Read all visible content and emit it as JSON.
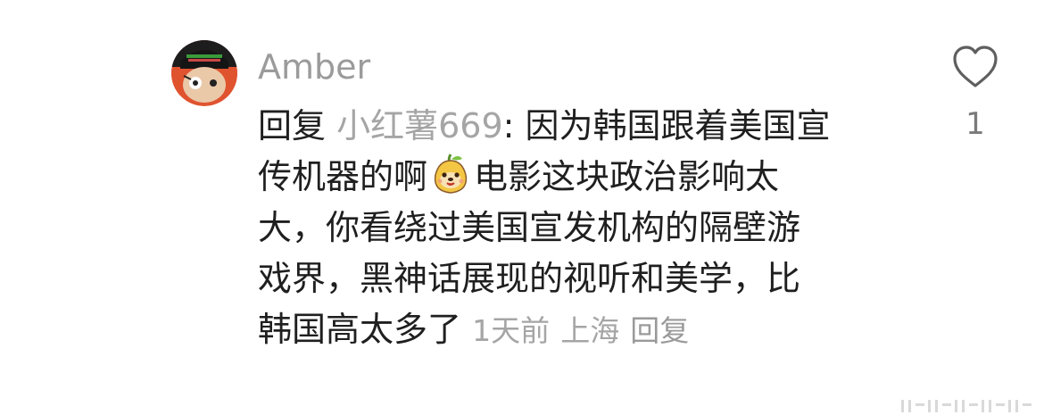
{
  "comment": {
    "avatar_icon": "movie-poster-avatar-icon",
    "username": "Amber",
    "reply_prefix": "回复",
    "reply_to": "小红薯669",
    "lines": {
      "l1": ": 因为韩国跟着美国宣",
      "l2a": "传机器的啊",
      "l2b": "电影这块政治影响太",
      "l3": "大，你看绕过美国宣发机构的隔壁游",
      "l4": "戏界，黑神话展现的视听和美学，比",
      "l5": "韩国高太多了"
    },
    "emoji_icon": "smiling-pear-face-emoji-icon",
    "time": "1天前",
    "location": "上海",
    "reply_label": "回复",
    "like_icon": "heart-outline-icon",
    "like_count": "1"
  },
  "colors": {
    "username": "#9b9b9b",
    "text": "#1f1f1f",
    "meta": "#a5a5a5",
    "avatar_bg": "#1a1a1a",
    "avatar_accent": "#e0532f"
  }
}
